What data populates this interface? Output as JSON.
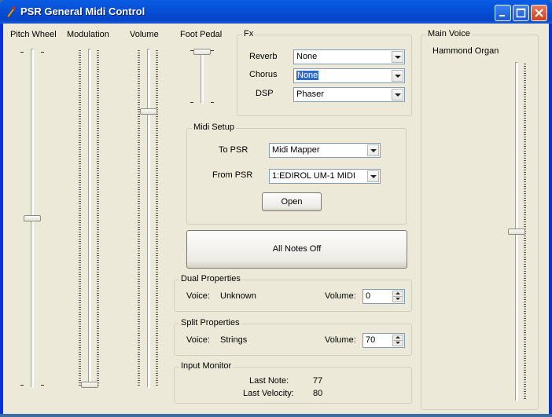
{
  "window": {
    "title": "PSR General Midi Control",
    "controls": [
      "minimize-icon",
      "maximize-icon",
      "close-icon"
    ]
  },
  "sliders": {
    "pitch_wheel": {
      "label": "Pitch Wheel",
      "level": 0.5
    },
    "modulation": {
      "label": "Modulation",
      "level": 0.0
    },
    "volume": {
      "label": "Volume",
      "level": 0.82
    },
    "foot_pedal": {
      "label": "Foot Pedal",
      "level": 1.0
    }
  },
  "fx": {
    "title": "Fx",
    "reverb": {
      "label": "Reverb",
      "value": "None"
    },
    "chorus": {
      "label": "Chorus",
      "value": "None"
    },
    "dsp": {
      "label": "DSP",
      "value": "Phaser"
    }
  },
  "midi_setup": {
    "title": "Midi Setup",
    "to_psr": {
      "label": "To PSR",
      "value": "Midi Mapper"
    },
    "from_psr": {
      "label": "From PSR",
      "value": "1:EDIROL UM-1 MIDI"
    },
    "open_label": "Open"
  },
  "all_notes_off_label": "All Notes Off",
  "dual": {
    "title": "Dual Properties",
    "voice_label": "Voice:",
    "voice_value": "Unknown",
    "volume_label": "Volume:",
    "volume_value": "0"
  },
  "split": {
    "title": "Split Properties",
    "voice_label": "Voice:",
    "voice_value": "Strings",
    "volume_label": "Volume:",
    "volume_value": "70"
  },
  "input_monitor": {
    "title": "Input Monitor",
    "last_note_label": "Last Note:",
    "last_note_value": "77",
    "last_velocity_label": "Last Velocity:",
    "last_velocity_value": "80"
  },
  "main_voice": {
    "title": "Main Voice",
    "voice_name": "Hammond Organ",
    "level": 0.5
  },
  "colors": {
    "titlebar": "#0550d8",
    "client_bg": "#ece9d8",
    "selection": "#316ac5",
    "close_button": "#c9451c"
  }
}
